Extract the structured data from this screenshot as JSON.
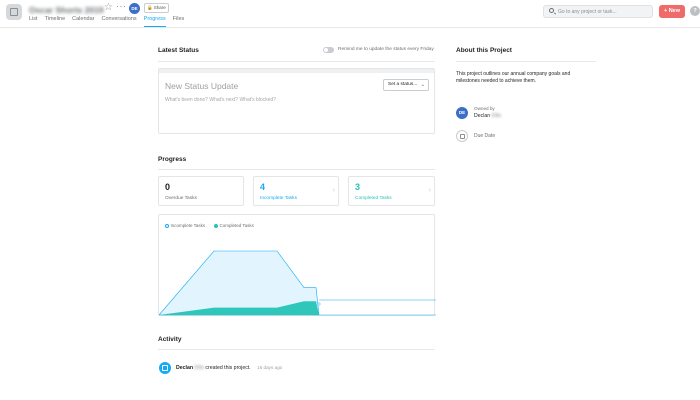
{
  "header": {
    "project_title": "Oscar Shorts 2019",
    "avatar_initials": "DE",
    "share_label": "Share",
    "tabs": [
      {
        "label": "List"
      },
      {
        "label": "Timeline"
      },
      {
        "label": "Calendar"
      },
      {
        "label": "Conversations"
      },
      {
        "label": "Progress",
        "active": true
      },
      {
        "label": "Files"
      }
    ],
    "search_placeholder": "Go to any project or task...",
    "new_label": "+ New",
    "help_label": "?"
  },
  "latest_status": {
    "title": "Latest Status",
    "remind_text": "Remind me to update the status every Friday",
    "remind_enabled": false,
    "card_title": "New Status Update",
    "card_prompt": "What's been done? What's next? What's blocked?",
    "set_status_label": "Set a status...",
    "chevron": "⌄"
  },
  "progress": {
    "title": "Progress",
    "cards": [
      {
        "value": "0",
        "label": "Overdue Tasks",
        "color": "#1e1f21"
      },
      {
        "value": "4",
        "label": "Incomplete Tasks",
        "color": "#14aaf5"
      },
      {
        "value": "3",
        "label": "Completed Tasks",
        "color": "#25c4b5"
      }
    ],
    "card_chevron": "›",
    "legend": {
      "incomplete": "Incomplete Tasks",
      "completed": "Completed Tasks"
    },
    "colors": {
      "incomplete": "#14aaf5",
      "completed": "#25c4b5"
    }
  },
  "chart_data": {
    "type": "area",
    "series": [
      {
        "name": "Incomplete Tasks",
        "values": [
          0,
          7,
          7,
          3,
          3,
          0,
          0,
          0
        ]
      },
      {
        "name": "Completed Tasks",
        "values": [
          0,
          0.8,
          0.8,
          1.5,
          1.5,
          0,
          0,
          0
        ]
      }
    ],
    "x": [
      0,
      1,
      2,
      3,
      4,
      5,
      6,
      7
    ],
    "ylim": [
      0,
      8
    ],
    "grid": false,
    "legend_placement": "top-left"
  },
  "activity": {
    "title": "Activity",
    "items": [
      {
        "actor_first": "Declan",
        "actor_last": "Ellis",
        "action": " created this project.",
        "time": "16 days ago"
      }
    ]
  },
  "about": {
    "title": "About this Project",
    "description": "This project outlines our annual company goals and milestones needed to achieve them.",
    "owned_by_label": "Owned by",
    "owner_first": "Declan",
    "owner_last": "Ellis",
    "owner_initials": "DE",
    "due_date_label": "Due Date"
  }
}
